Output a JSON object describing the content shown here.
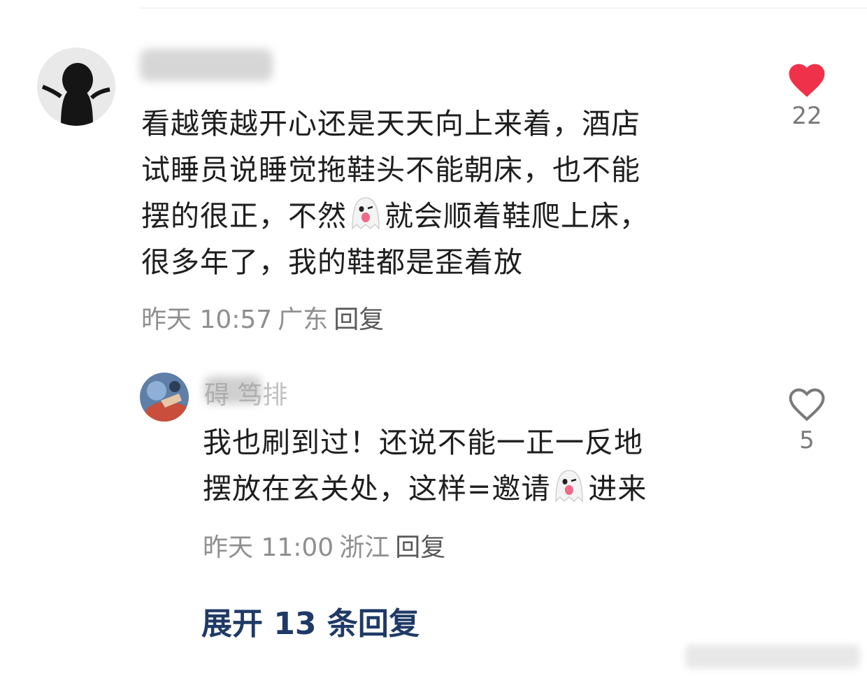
{
  "comments": [
    {
      "name_visible": "",
      "lines": [
        "看越策越开心还是天天向上来着，酒店",
        "试睡员说睡觉拖鞋头不能朝床，也不能",
        [
          "摆的很正，不然",
          "就会顺着鞋爬上床，"
        ],
        "很多年了，我的鞋都是歪着放"
      ],
      "time": "昨天 10:57",
      "location": "广东",
      "reply_label": "回复",
      "like_count": "22",
      "liked": true
    },
    {
      "name_visible": "碍  笃排",
      "lines": [
        "我也刷到过！还说不能一正一反地",
        [
          "摆放在玄关处，这样=邀请",
          "进来"
        ]
      ],
      "time": "昨天 11:00",
      "location": "浙江",
      "reply_label": "回复",
      "like_count": "5",
      "liked": false
    }
  ],
  "expand_label": "展开 13 条回复",
  "colors": {
    "liked_heart": "#f0314a",
    "expand_text": "#1f3a66",
    "meta_text": "#8f8f8f"
  },
  "icons": {
    "liked": "heart-filled-icon",
    "unliked": "heart-outline-icon",
    "emoji": "ghost-emoji-icon"
  }
}
